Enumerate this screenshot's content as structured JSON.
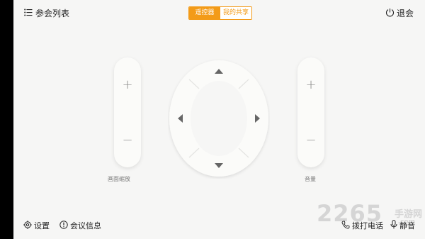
{
  "header": {
    "list_label": "参会列表",
    "tabs": [
      {
        "label": "遥控器",
        "active": true
      },
      {
        "label": "我的共享",
        "active": false
      }
    ],
    "exit_label": "退会"
  },
  "controls": {
    "zoom_caption": "画面缩放",
    "volume_caption": "音量",
    "plus": "+",
    "minus": "−"
  },
  "footer": {
    "settings_label": "设置",
    "info_label": "会议信息",
    "dial_label": "拨打电话",
    "mute_label": "静音"
  },
  "watermark": {
    "number": "2265",
    "cn": "手游网",
    "domain": ".com"
  },
  "colors": {
    "accent": "#f39b18",
    "background": "#f6f6f5"
  },
  "icons": [
    "list-icon",
    "power-icon",
    "gear-icon",
    "info-icon",
    "phone-icon",
    "microphone-icon",
    "arrow-up-icon",
    "arrow-down-icon",
    "arrow-left-icon",
    "arrow-right-icon"
  ]
}
